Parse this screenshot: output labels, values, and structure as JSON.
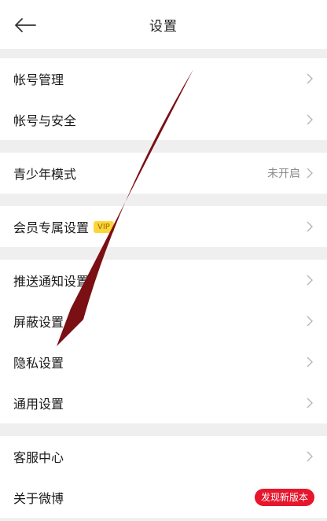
{
  "header": {
    "title": "设置"
  },
  "groups": [
    {
      "items": [
        {
          "label": "帐号管理"
        },
        {
          "label": "帐号与安全"
        }
      ]
    },
    {
      "items": [
        {
          "label": "青少年模式",
          "value": "未开启"
        }
      ]
    },
    {
      "items": [
        {
          "label": "会员专属设置",
          "badge": "VIP"
        }
      ]
    },
    {
      "items": [
        {
          "label": "推送通知设置"
        },
        {
          "label": "屏蔽设置"
        },
        {
          "label": "隐私设置"
        },
        {
          "label": "通用设置"
        }
      ]
    },
    {
      "items": [
        {
          "label": "客服中心"
        },
        {
          "label": "关于微博",
          "badge": "发现新版本"
        }
      ]
    }
  ],
  "colors": {
    "annotation_arrow": "#7a0f14",
    "new_badge": "#e6162d",
    "vip_badge": "#ffd63a"
  }
}
